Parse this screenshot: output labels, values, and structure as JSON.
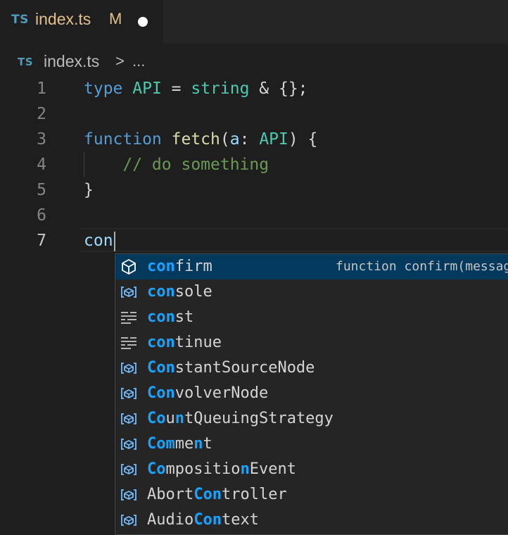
{
  "tab": {
    "badge": "TS",
    "title": "index.ts",
    "modified": "M"
  },
  "breadcrumb": {
    "badge": "TS",
    "file": "index.ts",
    "separator": ">",
    "more": "..."
  },
  "editor": {
    "lines": [
      {
        "number": "1",
        "tokens": [
          {
            "t": "type",
            "c": "kw"
          },
          {
            "t": " ",
            "c": "tx"
          },
          {
            "t": "API",
            "c": "ty"
          },
          {
            "t": " = ",
            "c": "tx"
          },
          {
            "t": "string",
            "c": "ty"
          },
          {
            "t": " & {};",
            "c": "tx"
          }
        ]
      },
      {
        "number": "2",
        "tokens": []
      },
      {
        "number": "3",
        "tokens": [
          {
            "t": "function",
            "c": "kw"
          },
          {
            "t": " ",
            "c": "tx"
          },
          {
            "t": "fetch",
            "c": "fn"
          },
          {
            "t": "(",
            "c": "tx"
          },
          {
            "t": "a",
            "c": "pm"
          },
          {
            "t": ": ",
            "c": "tx"
          },
          {
            "t": "API",
            "c": "ty"
          },
          {
            "t": ") {",
            "c": "tx"
          }
        ]
      },
      {
        "number": "4",
        "tokens": [
          {
            "t": "    ",
            "c": "tx"
          },
          {
            "t": "// do something",
            "c": "cm"
          }
        ]
      },
      {
        "number": "5",
        "tokens": [
          {
            "t": "}",
            "c": "tx"
          }
        ]
      },
      {
        "number": "6",
        "tokens": []
      },
      {
        "number": "7",
        "tokens": [
          {
            "t": "con",
            "c": "pm"
          }
        ],
        "cursor": true
      }
    ],
    "active_line": "7"
  },
  "suggest": {
    "items": [
      {
        "icon": "method-icon",
        "parts": [
          {
            "t": "con",
            "h": true
          },
          {
            "t": "firm",
            "h": false
          }
        ],
        "detail": "function confirm(message?: string): boolean",
        "selected": true
      },
      {
        "icon": "variable-icon",
        "parts": [
          {
            "t": "con",
            "h": true
          },
          {
            "t": "sole",
            "h": false
          }
        ]
      },
      {
        "icon": "snippet-icon",
        "parts": [
          {
            "t": "con",
            "h": true
          },
          {
            "t": "st",
            "h": false
          }
        ]
      },
      {
        "icon": "snippet-icon",
        "parts": [
          {
            "t": "con",
            "h": true
          },
          {
            "t": "tinue",
            "h": false
          }
        ]
      },
      {
        "icon": "variable-icon",
        "parts": [
          {
            "t": "Con",
            "h": true
          },
          {
            "t": "stantSourceNode",
            "h": false
          }
        ]
      },
      {
        "icon": "variable-icon",
        "parts": [
          {
            "t": "Con",
            "h": true
          },
          {
            "t": "volverNode",
            "h": false
          }
        ]
      },
      {
        "icon": "variable-icon",
        "parts": [
          {
            "t": "Co",
            "h": true
          },
          {
            "t": "u",
            "h": false
          },
          {
            "t": "n",
            "h": true
          },
          {
            "t": "tQueuingStrategy",
            "h": false
          }
        ]
      },
      {
        "icon": "variable-icon",
        "parts": [
          {
            "t": "Com",
            "h": true
          },
          {
            "t": "me",
            "h": false
          },
          {
            "t": "n",
            "h": true
          },
          {
            "t": "t",
            "h": false
          }
        ]
      },
      {
        "icon": "variable-icon",
        "parts": [
          {
            "t": "Co",
            "h": true
          },
          {
            "t": "mpositio",
            "h": false
          },
          {
            "t": "n",
            "h": true
          },
          {
            "t": "Event",
            "h": false
          }
        ]
      },
      {
        "icon": "variable-icon",
        "parts": [
          {
            "t": "Abort",
            "h": false
          },
          {
            "t": "Con",
            "h": true
          },
          {
            "t": "troller",
            "h": false
          }
        ]
      },
      {
        "icon": "variable-icon",
        "parts": [
          {
            "t": "Audio",
            "h": false
          },
          {
            "t": "Con",
            "h": true
          },
          {
            "t": "text",
            "h": false
          }
        ]
      }
    ]
  },
  "colors": {
    "background": "#1e1e1e",
    "keyword": "#569cd6",
    "type": "#4ec9b0",
    "function": "#dcdcaa",
    "parameter": "#9cdcfe",
    "comment": "#6a9955",
    "match_highlight": "#18a3ff",
    "selection": "#04395e",
    "modified": "#e2c08d"
  }
}
